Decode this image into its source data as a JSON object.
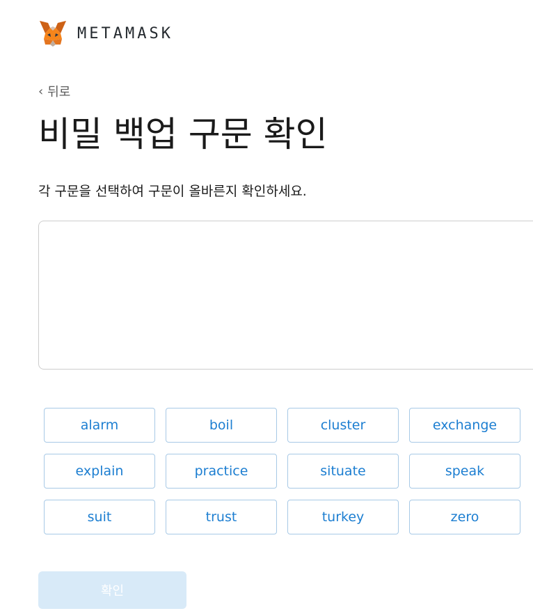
{
  "header": {
    "brand": "METAMASK",
    "logo_icon": "metamask-fox-icon"
  },
  "back": {
    "label": "뒤로",
    "icon": "chevron-left-icon"
  },
  "title": "비밀 백업 구문 확인",
  "instructions": "각 구문을 선택하여 구문이 올바른지 확인하세요.",
  "phrase_box": {
    "selected_words": []
  },
  "words": [
    "alarm",
    "boil",
    "cluster",
    "exchange",
    "explain",
    "practice",
    "situate",
    "speak",
    "suit",
    "trust",
    "turkey",
    "zero"
  ],
  "confirm_button": {
    "label": "확인",
    "state": "disabled"
  },
  "colors": {
    "accent": "#1c7ed1",
    "word_border": "#a7c9e6",
    "button_disabled": "#d8eaf8"
  }
}
